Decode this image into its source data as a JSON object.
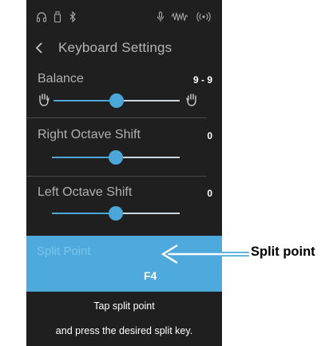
{
  "header": {
    "title": "Keyboard Settings"
  },
  "status_icons": [
    "headphones-icon",
    "usb-memory-icon",
    "bluetooth-icon",
    "mic-icon",
    "audio-wave-icon",
    "wireless-icon"
  ],
  "settings": {
    "balance": {
      "label": "Balance",
      "value": "9 - 9",
      "level": 0.5
    },
    "right_octave": {
      "label": "Right Octave Shift",
      "value": "0",
      "level": 0.5
    },
    "left_octave": {
      "label": "Left Octave Shift",
      "value": "0",
      "level": 0.5
    },
    "split_point": {
      "label": "Split Point",
      "value": "F4"
    }
  },
  "hint": {
    "line1": "Tap split point",
    "line2": "and press the desired split key."
  },
  "callout": {
    "label": "Split point"
  },
  "colors": {
    "accent": "#4ea9dc",
    "background": "#1f1f1f",
    "arrow": "#ffffff"
  }
}
